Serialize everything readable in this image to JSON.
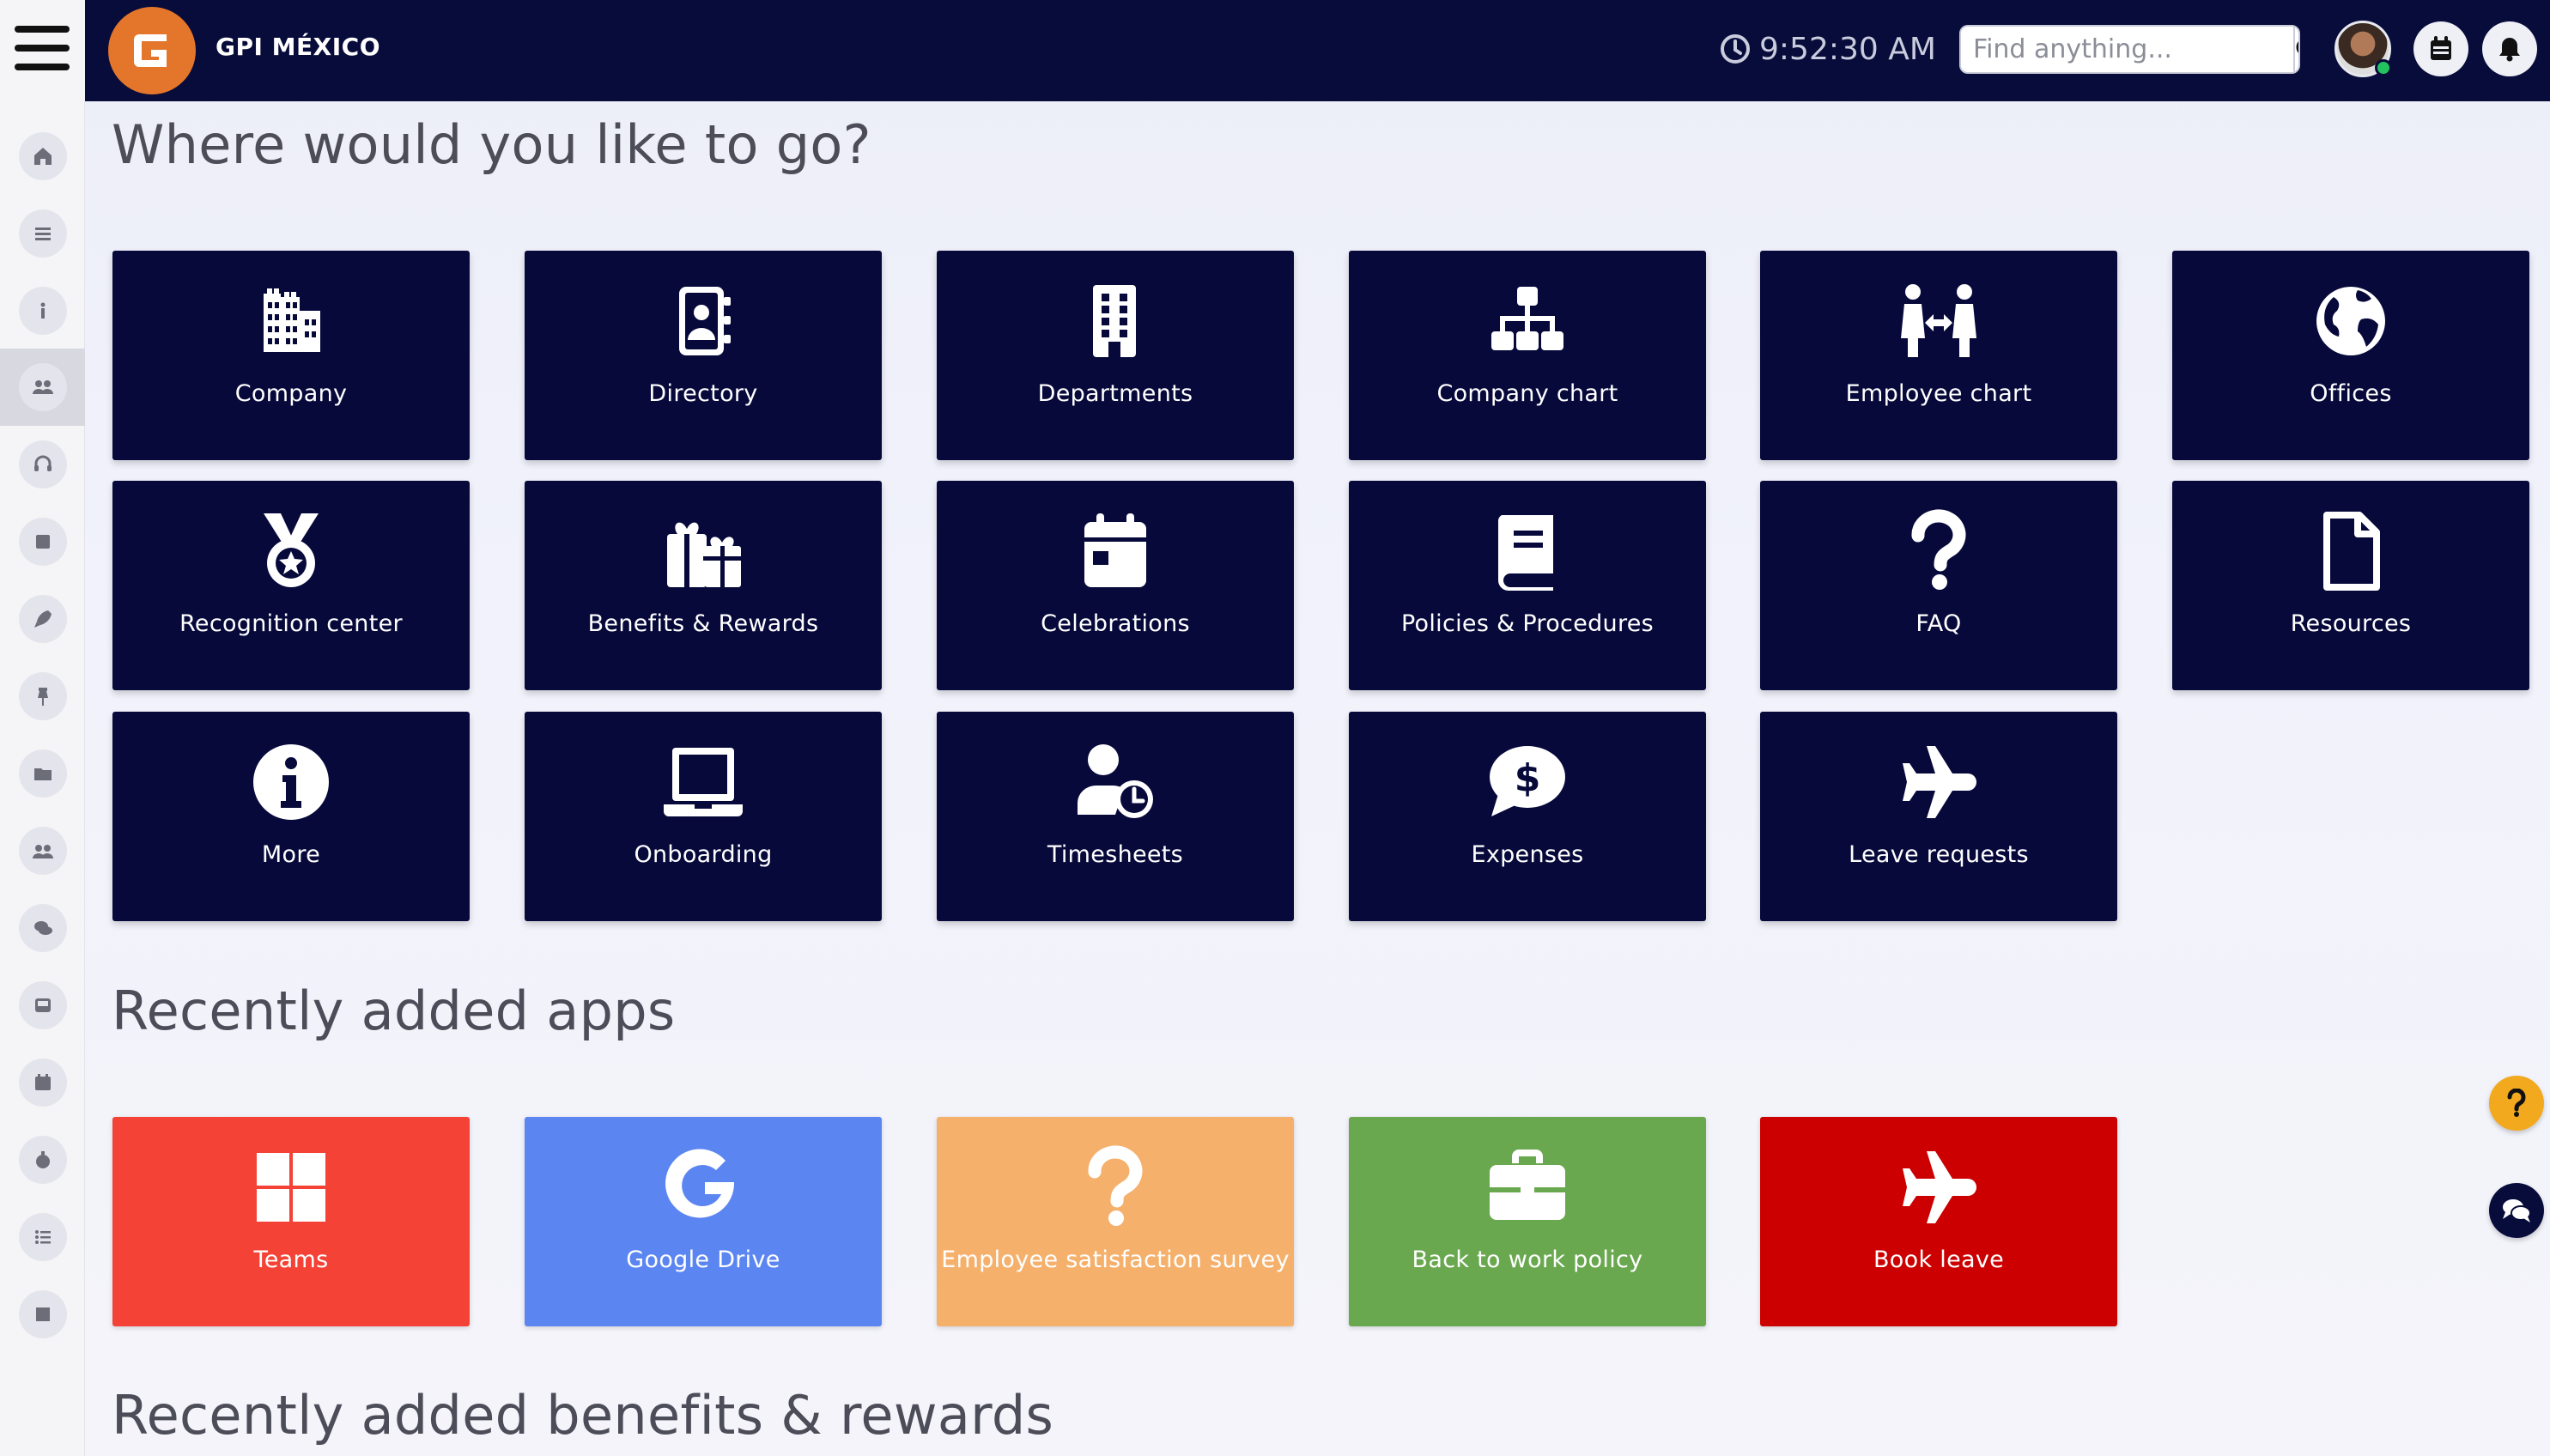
{
  "header": {
    "brand": "GPI MÉXICO",
    "time": "9:52:30 AM",
    "search_placeholder": "Find anything..."
  },
  "sections": {
    "where": "Where would you like to go?",
    "apps": "Recently added apps",
    "benefits": "Recently added benefits & rewards"
  },
  "nav_tiles": [
    {
      "label": "Company",
      "icon": "building-icon"
    },
    {
      "label": "Directory",
      "icon": "address-book-icon"
    },
    {
      "label": "Departments",
      "icon": "office-building-icon"
    },
    {
      "label": "Company chart",
      "icon": "org-chart-icon"
    },
    {
      "label": "Employee chart",
      "icon": "people-arrows-icon"
    },
    {
      "label": "Offices",
      "icon": "globe-icon"
    },
    {
      "label": "Recognition center",
      "icon": "medal-icon"
    },
    {
      "label": "Benefits & Rewards",
      "icon": "gifts-icon"
    },
    {
      "label": "Celebrations",
      "icon": "calendar-day-icon"
    },
    {
      "label": "Policies & Procedures",
      "icon": "book-icon"
    },
    {
      "label": "FAQ",
      "icon": "question-icon"
    },
    {
      "label": "Resources",
      "icon": "file-icon"
    },
    {
      "label": "More",
      "icon": "info-circle-icon"
    },
    {
      "label": "Onboarding",
      "icon": "laptop-icon"
    },
    {
      "label": "Timesheets",
      "icon": "user-clock-icon"
    },
    {
      "label": "Expenses",
      "icon": "dollar-comment-icon"
    },
    {
      "label": "Leave requests",
      "icon": "plane-icon"
    }
  ],
  "app_tiles": [
    {
      "label": "Teams",
      "icon": "windows-icon",
      "color": "#f44336"
    },
    {
      "label": "Google Drive",
      "icon": "google-icon",
      "color": "#5b85f1"
    },
    {
      "label": "Employee satisfaction survey",
      "icon": "question-icon",
      "color": "#f5b06c"
    },
    {
      "label": "Back to work policy",
      "icon": "briefcase-icon",
      "color": "#6aa84f"
    },
    {
      "label": "Book leave",
      "icon": "plane-icon",
      "color": "#cc0000"
    }
  ],
  "colors": {
    "topbar": "#080c3a",
    "tile": "#07093b",
    "logo": "#e4762b",
    "help_fab": "#f2a91d",
    "chat_fab": "#080c3a"
  },
  "sidebar_icons": [
    "home-icon",
    "list-icon",
    "info-icon",
    "users-icon",
    "headset-icon",
    "square-icon",
    "rocket-icon",
    "pin-icon",
    "folder-icon",
    "group-icon",
    "chat-icon",
    "inbox-icon",
    "calendar-icon",
    "stopwatch-icon",
    "list-ul-icon",
    "box-icon"
  ]
}
